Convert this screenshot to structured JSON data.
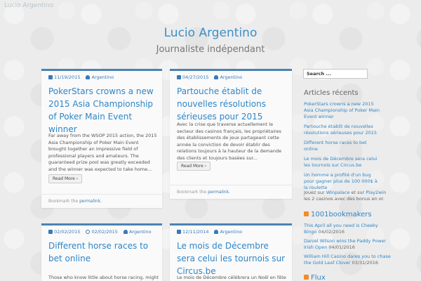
{
  "header": {
    "topbar_title": "Lucio Argentino",
    "site_title": "Lucio Argentino",
    "site_description": "Journaliste indépendant"
  },
  "posts": [
    {
      "date": "11/19/2015",
      "author": "Argentino",
      "title": "PokerStars crowns a new 2015 Asia Championship of Poker Main Event winner",
      "excerpt": "Far away from the WSOP 2015 action, the 2015 Asia Championship of Poker Main Event brought together an impressive field of professional players and amateurs. The guaranteed prize pool was greatly exceeded and the winner was expected to take home...",
      "read_more": "Read More",
      "footer_text": "Bookmark the",
      "footer_link": "permalink."
    },
    {
      "date": "04/27/2015",
      "author": "Argentino",
      "title": "Partouche établit de nouvelles résolutions sérieuses pour 2015",
      "excerpt": "Avec la crise que traverse actuellement le secteur des casinos français, les propriétaires des établissements de jeux partageant cette année la conviction de devoir établir des relations toujours à la hauteur de la demande des clients et toujours basées sur...",
      "read_more": "Read More",
      "footer_text": "Bookmark the",
      "footer_link": "permalink."
    },
    {
      "date": "02/02/2015",
      "date2": "02/02/2015",
      "author": "Argentino",
      "title": "Different horse races to bet online",
      "excerpt": "Those who know little about horse racing, might find"
    },
    {
      "date": "12/11/2014",
      "author": "Argentino",
      "title": "Le mois de Décembre sera celui les tournois sur Circus.be",
      "excerpt": "Le mois de Décembre célébrera un Noël en fête sur"
    }
  ],
  "sidebar": {
    "search_placeholder": "Search ...",
    "recent_title": "Articles récents",
    "recent_items": [
      "PokerStars crowns a new 2015 Asia Championship of Poker Main Event winner",
      "Partouche établit de nouvelles résolutions sérieuses pour 2015",
      "Different horse races to bet online",
      "Le mois de Décembre sera celui les tournois sur Circus.be",
      "Un homme a profité d'un bug pour gagner plus de 100 000$ à la roulette"
    ],
    "promo_prefix": "Jouez sur",
    "promo_link1": "Winpalace",
    "promo_mid": "et sur",
    "promo_link2": "Play2win",
    "promo_suffix": "les 2 casinos avec des bonus en or.",
    "rss_title": "1001bookmakers",
    "rss_items": [
      {
        "text": "This April all you need is Cheeky Bingo",
        "date": "04/02/2016"
      },
      {
        "text": "Daniel Wilson wins the Paddy Power Irish Open",
        "date": "04/01/2016"
      },
      {
        "text": "William Hill Casino dares you to chase the Gold Leaf Clover",
        "date": "03/31/2016"
      }
    ],
    "rss_title2": "Flux"
  }
}
